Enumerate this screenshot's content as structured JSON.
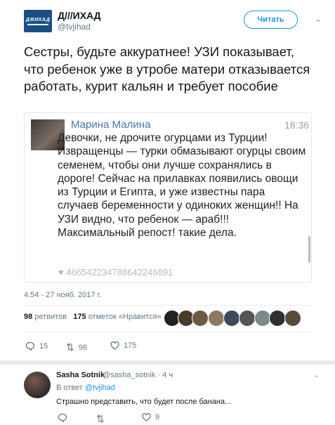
{
  "author": {
    "logo_text": "ДЖИХАД",
    "name": "Д///ИХАД",
    "handle": "@tvjihad"
  },
  "follow_button": "Читать",
  "tweet_text": "Сестры, будьте аккуратнее! УЗИ показывает, что ребенок уже в утробе матери отказывается работать, курит кальян и требует пособие",
  "card": {
    "name": "Марина Малина",
    "time": "18:36",
    "message": "Девочки, не дрочите огурцами из Турции! Извращенцы — турки обмазывают огурцы своим семенем, чтобы они лучше сохранялись в дороге! Сейчас на прилавках появились овощи из Турции и Египта, и уже известны пара случаев беременности у одиноких женщин!! На УЗИ видно, что ребенок — араб!!! Максимальный репост! такие дела.",
    "likes": "4665422347886422468​91"
  },
  "timestamp": "4:54 - 27 нояб. 2017 г.",
  "stats": {
    "retweets_count": "98",
    "retweets_label": "ретвитов",
    "likes_count": "175",
    "likes_label": "отметок «Нравится»"
  },
  "actions": {
    "replies": "15",
    "retweets": "98",
    "likes": "175"
  },
  "reply": {
    "name": "Sasha Sotnik",
    "handle": "@sasha_sotnik · 4 ч",
    "reply_to_prefix": "В ответ",
    "reply_to_handle": "@tvjihad",
    "text": "Страшно представить, что будет после банана...",
    "actions": {
      "replies": "",
      "retweets": "",
      "likes": "9"
    }
  },
  "colors": {
    "accent": "#1b95e0",
    "muted": "#657786",
    "like": "#e0245e"
  }
}
